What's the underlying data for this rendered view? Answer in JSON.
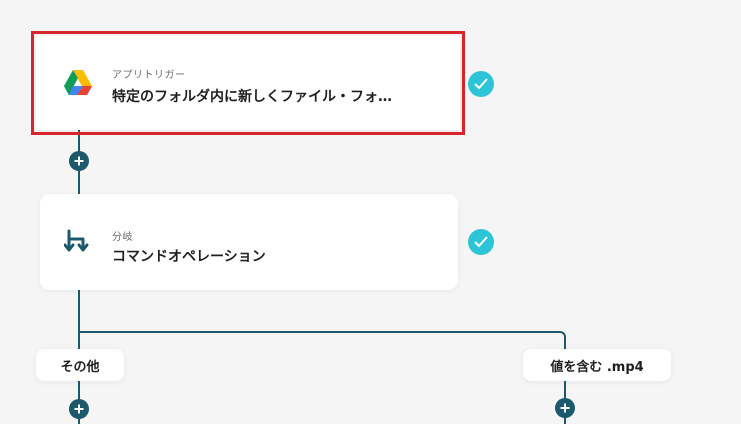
{
  "flow": {
    "trigger": {
      "label": "アプリトリガー",
      "title": "特定のフォルダ内に新しくファイル・フォ…",
      "icon": "google-drive-icon",
      "status": "check-icon"
    },
    "branch": {
      "label": "分岐",
      "title": "コマンドオペレーション",
      "icon": "branch-icon",
      "status": "check-icon"
    },
    "paths": {
      "left": "その他",
      "right": "値を含む .mp4"
    }
  },
  "colors": {
    "connector": "#1c5a6b",
    "check": "#2cc4d6",
    "selection": "#d7262b",
    "branch_icon": "#1c5a6b"
  }
}
